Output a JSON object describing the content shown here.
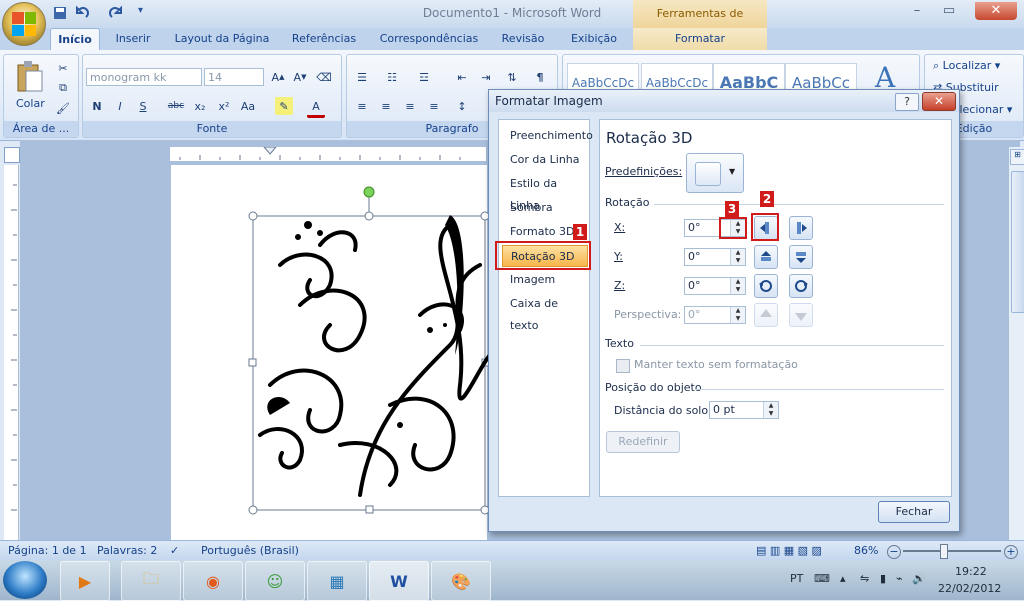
{
  "window": {
    "title": "Documento1 - Microsoft Word",
    "context_tab_title": "Ferramentas de Imagem",
    "controls": {
      "minimize": "–",
      "maximize": "▭",
      "close": "✕"
    }
  },
  "ribbon": {
    "tabs": [
      "Início",
      "Inserir",
      "Layout da Página",
      "Referências",
      "Correspondências",
      "Revisão",
      "Exibição",
      "Formatar"
    ],
    "clipboard": {
      "paste_label": "Colar",
      "group_label": "Área de ..."
    },
    "font": {
      "name": "monogram kk",
      "size": "14",
      "group_label": "Fonte"
    },
    "paragraph": {
      "group_label": "Paragrafo"
    },
    "styles": [
      "AaBbCcDc",
      "AaBbCcDc",
      "AaBbC",
      "AaBbCc"
    ],
    "editing": {
      "find": "Localizar",
      "replace": "Substituir",
      "select": "Selecionar",
      "group_label": "Edição"
    }
  },
  "statusbar": {
    "page": "Página: 1 de 1",
    "words": "Palavras: 2",
    "language": "Português (Brasil)",
    "zoom": "86%"
  },
  "taskbar": {
    "lang": "PT",
    "time": "19:22",
    "date": "22/02/2012"
  },
  "dialog": {
    "title": "Formatar Imagem",
    "help": "?",
    "close": "✕",
    "nav": [
      "Preenchimento",
      "Cor da Linha",
      "Estilo da Linha",
      "Sombra",
      "Formato 3D",
      "Rotação 3D",
      "Imagem",
      "Caixa de texto"
    ],
    "selected_nav": "Rotação 3D",
    "panel": {
      "heading": "Rotação 3D",
      "presets_label": "Predefinições:",
      "rotation_section": "Rotação",
      "x_label": "X:",
      "x_value": "0°",
      "y_label": "Y:",
      "y_value": "0°",
      "z_label": "Z:",
      "z_value": "0°",
      "perspective_label": "Perspectiva:",
      "perspective_value": "0°",
      "text_section": "Texto",
      "keep_flat_label": "Manter texto sem formatação",
      "position_section": "Posição do objeto",
      "distance_label": "Distância do solo:",
      "distance_value": "0 pt",
      "reset_label": "Redefinir"
    },
    "close_button": "Fechar",
    "annotations": [
      "1",
      "2",
      "3"
    ]
  }
}
